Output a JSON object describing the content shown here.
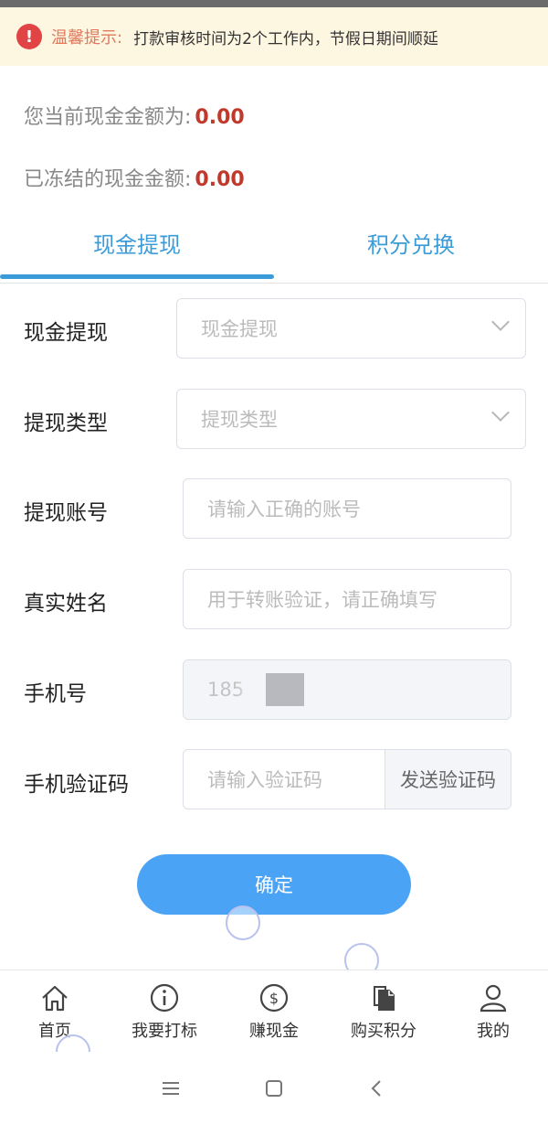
{
  "notice": {
    "icon": "exclamation-icon",
    "icon_text": "!",
    "title": "温馨提示:",
    "text": "打款审核时间为2个工作内，节假日期间顺延"
  },
  "balances": [
    {
      "label": "您当前现金金额为:",
      "amount": "0.00"
    },
    {
      "label": "已冻结的现金金额:",
      "amount": "0.00"
    }
  ],
  "tabs": [
    {
      "label": "现金提现",
      "active": true
    },
    {
      "label": "积分兑换",
      "active": false
    }
  ],
  "form": {
    "withdraw": {
      "label": "现金提现",
      "placeholder": "现金提现"
    },
    "type": {
      "label": "提现类型",
      "placeholder": "提现类型"
    },
    "account": {
      "label": "提现账号",
      "placeholder": "请输入正确的账号"
    },
    "name": {
      "label": "真实姓名",
      "placeholder": "用于转账验证，请正确填写"
    },
    "phone": {
      "label": "手机号",
      "value": "185"
    },
    "code": {
      "label": "手机验证码",
      "placeholder": "请输入验证码",
      "send_label": "发送验证码"
    }
  },
  "submit_label": "确定",
  "bottom_nav": [
    {
      "label": "首页",
      "icon": "home-icon"
    },
    {
      "label": "我要打标",
      "icon": "info-icon"
    },
    {
      "label": "赚现金",
      "icon": "dollar-icon"
    },
    {
      "label": "购买积分",
      "icon": "documents-icon"
    },
    {
      "label": "我的",
      "icon": "user-icon"
    }
  ],
  "colors": {
    "accent": "#3a9bd9",
    "button": "#4aa3f5",
    "amount": "#c0392b",
    "notice_bg": "#fdf6e0"
  }
}
